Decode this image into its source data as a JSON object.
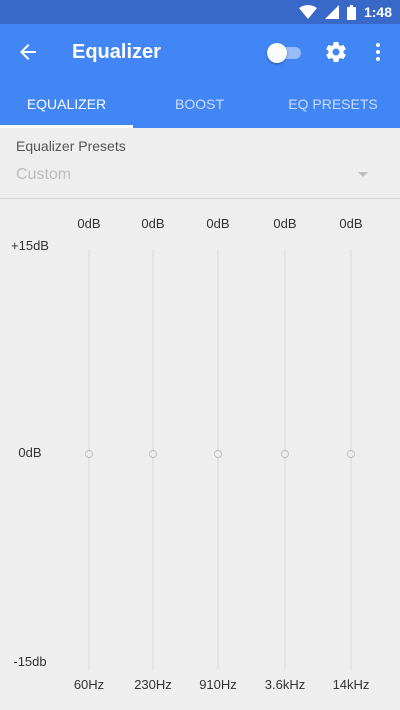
{
  "status_bar": {
    "time": "1:48"
  },
  "app_bar": {
    "title": "Equalizer",
    "toggle_on": false
  },
  "tabs": [
    {
      "label": "EQUALIZER",
      "active": true
    },
    {
      "label": "BOOST",
      "active": false
    },
    {
      "label": "EQ PRESETS",
      "active": false
    }
  ],
  "presets": {
    "label": "Equalizer Presets",
    "selected": "Custom"
  },
  "scale": {
    "max": "+15dB",
    "mid": "0dB",
    "min": "-15db"
  },
  "bands": [
    {
      "freq": "60Hz",
      "gain": "0dB"
    },
    {
      "freq": "230Hz",
      "gain": "0dB"
    },
    {
      "freq": "910Hz",
      "gain": "0dB"
    },
    {
      "freq": "3.6kHz",
      "gain": "0dB"
    },
    {
      "freq": "14kHz",
      "gain": "0dB"
    }
  ],
  "colors": {
    "status_bar": "#3869c9",
    "app_bar": "#4285f4",
    "background": "#eeeeee"
  }
}
